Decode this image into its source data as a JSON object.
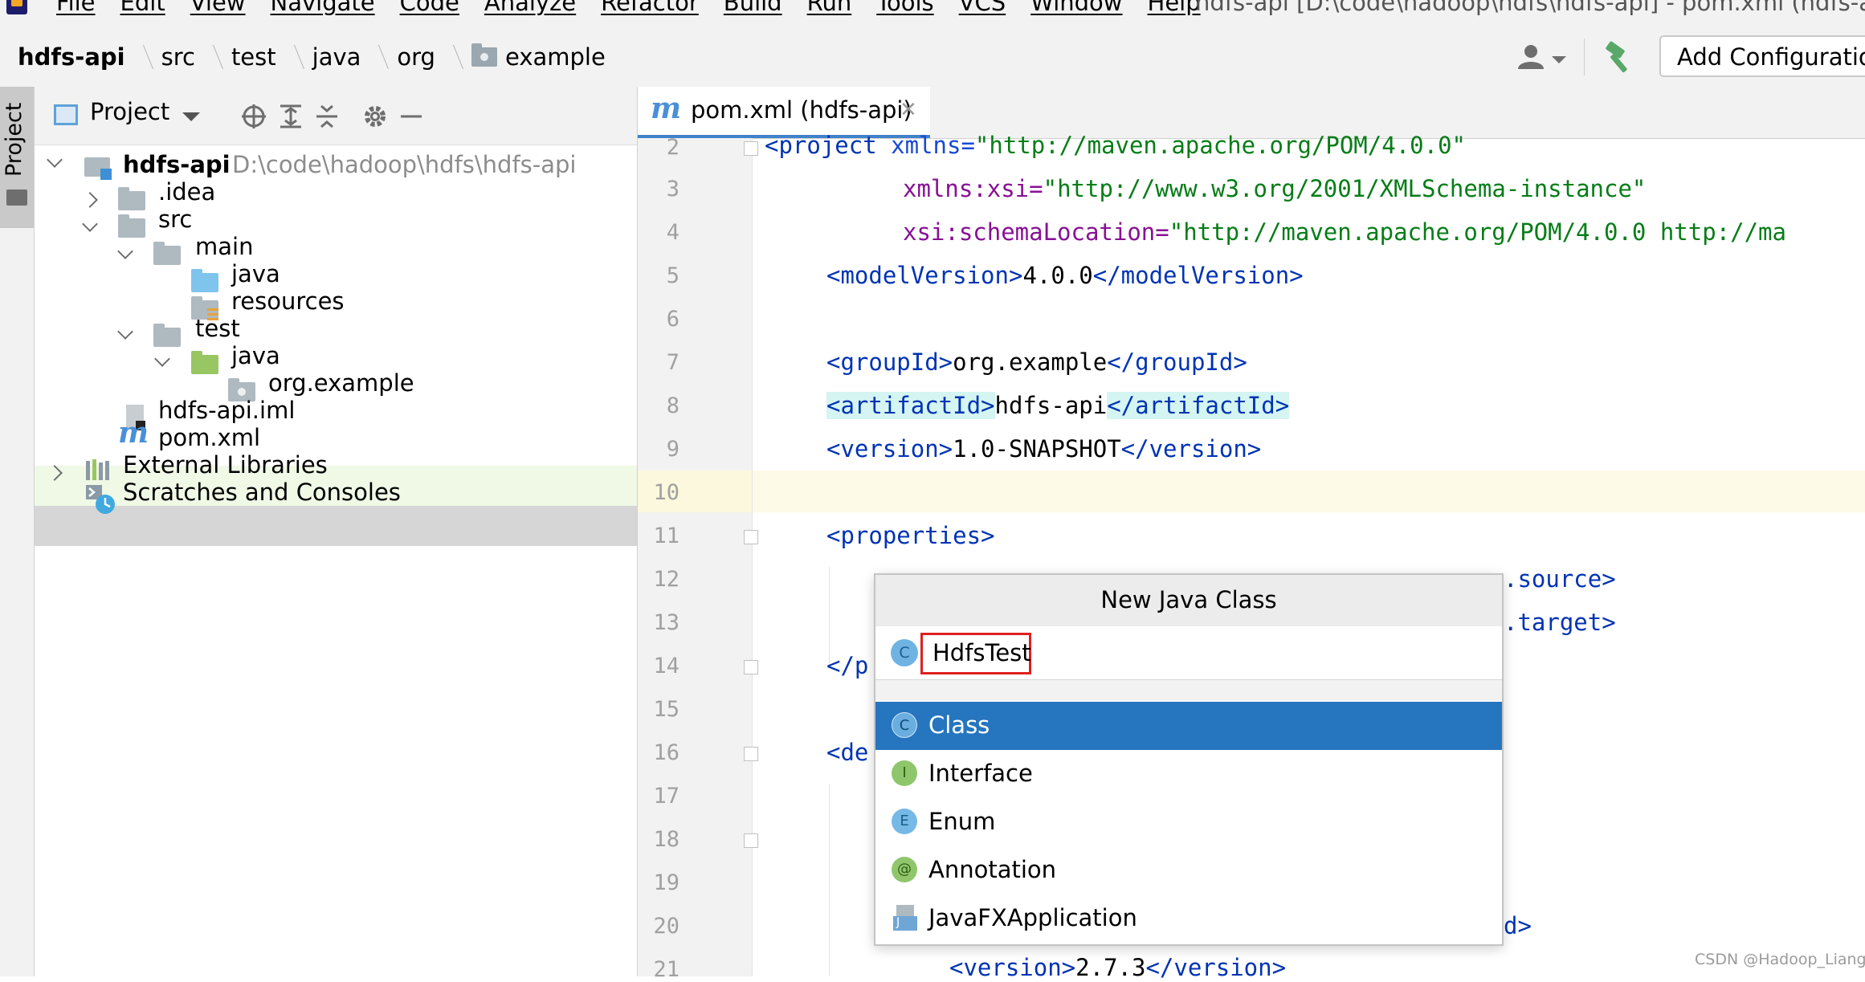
{
  "menubar": {
    "items": [
      "File",
      "Edit",
      "View",
      "Navigate",
      "Code",
      "Analyze",
      "Refactor",
      "Build",
      "Run",
      "Tools",
      "VCS",
      "Window",
      "Help"
    ],
    "window_title": "hdfs-api [D:\\code\\hadoop\\hdfs\\hdfs-api] - pom.xml (hdfs-api)"
  },
  "navbar": {
    "breadcrumb": [
      "hdfs-api",
      "src",
      "test",
      "java",
      "org",
      "example"
    ],
    "add_configuration": "Add Configuration..."
  },
  "left_stripe": {
    "project_label": "Project"
  },
  "project_panel": {
    "title": "Project",
    "tree": [
      {
        "label": "hdfs-api",
        "path": "D:\\code\\hadoop\\hdfs\\hdfs-api"
      },
      {
        "label": ".idea"
      },
      {
        "label": "src"
      },
      {
        "label": "main"
      },
      {
        "label": "java"
      },
      {
        "label": "resources"
      },
      {
        "label": "test"
      },
      {
        "label": "java"
      },
      {
        "label": "org.example"
      },
      {
        "label": "hdfs-api.iml"
      },
      {
        "label": "pom.xml"
      },
      {
        "label": "External Libraries"
      },
      {
        "label": "Scratches and Consoles"
      }
    ]
  },
  "editor": {
    "tab_label": "pom.xml (hdfs-api)",
    "line_numbers": [
      "2",
      "3",
      "4",
      "5",
      "6",
      "7",
      "8",
      "9",
      "10",
      "11",
      "12",
      "13",
      "14",
      "15",
      "16",
      "17",
      "18",
      "19",
      "20",
      "21"
    ],
    "code": {
      "l2_a": "<project ",
      "l2_b": "xmlns=",
      "l2_c": "\"http://maven.apache.org/POM/4.0.0\"",
      "l3_a": "xmlns:xsi=",
      "l3_b": "\"http://www.w3.org/2001/XMLSchema-instance\"",
      "l4_a": "xsi:schemaLocation=",
      "l4_b": "\"http://maven.apache.org/POM/4.0.0 http://ma",
      "l5_a": "<modelVersion>",
      "l5_b": "4.0.0",
      "l5_c": "</modelVersion>",
      "l7_a": "<groupId>",
      "l7_b": "org.example",
      "l7_c": "</groupId>",
      "l8_a": "<artifactId>",
      "l8_b": "hdfs-api",
      "l8_c": "</artifactId>",
      "l9_a": "<version>",
      "l9_b": "1.0-SNAPSHOT",
      "l9_c": "</version>",
      "l11": "<properties>",
      "l12": ".source>",
      "l13": ".target>",
      "l14": "</p",
      "l16": "<de",
      "l20": "d>",
      "l21_a": "<version>",
      "l21_b": "2.7.3",
      "l21_c": "</version>"
    }
  },
  "popup": {
    "title": "New Java Class",
    "input_value": "HdfsTest",
    "input_badge": "C",
    "kinds": [
      {
        "label": "Class",
        "badge": "C"
      },
      {
        "label": "Interface",
        "badge": "I"
      },
      {
        "label": "Enum",
        "badge": "E"
      },
      {
        "label": "Annotation",
        "badge": "@"
      },
      {
        "label": "JavaFXApplication",
        "badge": "J"
      }
    ]
  },
  "watermark": "CSDN @Hadoop_Liang",
  "colors": {
    "selection": "#2675bf",
    "input_border": "#e02020",
    "tag": "#0033b3",
    "string": "#067d17"
  }
}
